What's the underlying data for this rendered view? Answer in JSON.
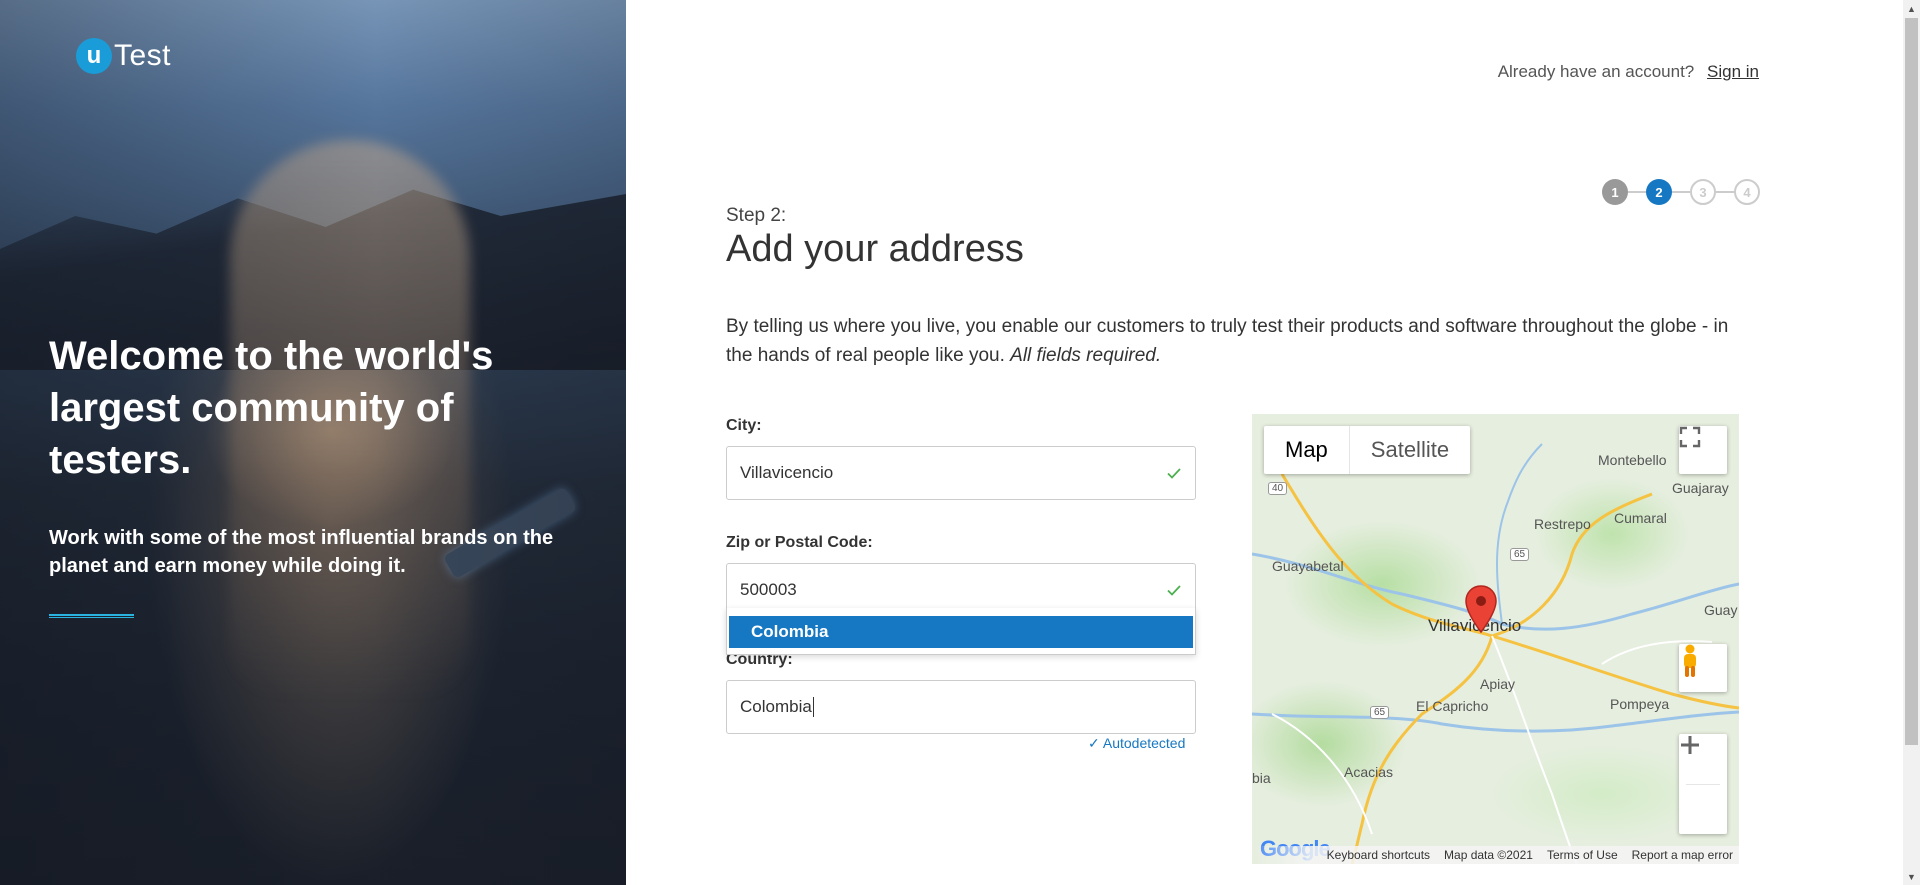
{
  "brand": {
    "logo_mark": "u",
    "logo_text": "Test"
  },
  "hero": {
    "title": "Welcome to the world's largest community of testers.",
    "subtitle": "Work with some of the most influential brands on the planet and earn money while doing it."
  },
  "header": {
    "already_text": "Already have an account?",
    "signin_label": "Sign in"
  },
  "stepper": {
    "steps": [
      "1",
      "2",
      "3",
      "4"
    ],
    "current": 2
  },
  "page": {
    "step_label": "Step 2:",
    "title": "Add your address",
    "intro": "By telling us where you live, you enable our customers to truly test their products and software throughout the globe - in the hands of real people like you.",
    "intro_emphasis": "All fields required."
  },
  "form": {
    "city": {
      "label": "City:",
      "value": "Villavicencio"
    },
    "zip": {
      "label": "Zip or Postal Code:",
      "value": "500003"
    },
    "country": {
      "label": "Country:",
      "value": "Colombia",
      "autodetected": "Autodetected"
    },
    "suggestions": [
      "Colombia"
    ]
  },
  "map": {
    "type_map": "Map",
    "type_satellite": "Satellite",
    "city": "Villavicencio",
    "places": [
      "Montebello",
      "Guajaray",
      "Restrepo",
      "Cumaral",
      "Guayabetal",
      "Apiay",
      "Pompeya",
      "El Capricho",
      "Acacias",
      "Guay",
      "bia"
    ],
    "routes": [
      "40",
      "65",
      "65"
    ],
    "footer": [
      "Keyboard shortcuts",
      "Map data ©2021",
      "Terms of Use",
      "Report a map error"
    ],
    "google": "Google"
  },
  "colors": {
    "accent": "#1678c2",
    "success": "#4caf50",
    "brand": "#1a9cd8"
  }
}
